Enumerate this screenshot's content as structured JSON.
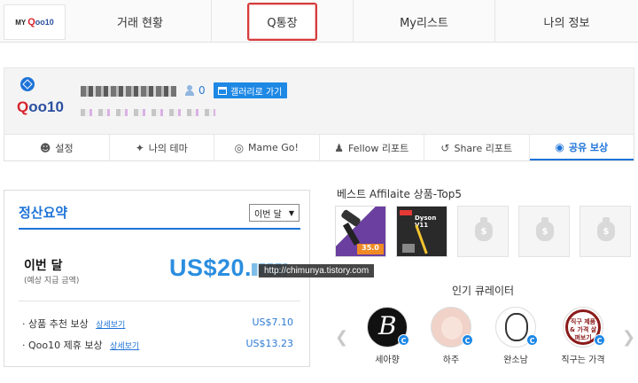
{
  "logo": {
    "my": "MY",
    "q": "Q",
    "rest": "oo10"
  },
  "nav": [
    {
      "label": "거래 현황"
    },
    {
      "label": "Q통장"
    },
    {
      "label": "My리스트"
    },
    {
      "label": "나의 정보"
    }
  ],
  "profile": {
    "logo_text_a": "Q",
    "logo_text_b": "oo10",
    "follower_count": "0",
    "gallery_button": "갤러리로 가기"
  },
  "subtabs": [
    {
      "label": "설정",
      "icon": "person-gear-icon"
    },
    {
      "label": "나의 테마",
      "icon": "magic-wand-icon"
    },
    {
      "label": "Mame Go!",
      "icon": "lifebuoy-icon"
    },
    {
      "label": "Fellow 리포트",
      "icon": "person-icon"
    },
    {
      "label": "Share 리포트",
      "icon": "share-icon"
    },
    {
      "label": "공유 보상",
      "icon": "piggy-bank-icon"
    }
  ],
  "settlement": {
    "title": "정산요약",
    "period_select": "이번 달",
    "month_label": "이번 달",
    "estimate_note": "(예상 지급 금액)",
    "amount_prefix": "US$20.",
    "rows": [
      {
        "label": "· 상품 추천 보상",
        "detail": "상세보기",
        "value": "US$7.10"
      },
      {
        "label": "· Qoo10 제휴 보상",
        "detail": "상세보기",
        "value": "US$13.23"
      }
    ]
  },
  "watermark": "http://chimunya.tistory.com",
  "best": {
    "title": "베스트 Affilaite 상품-Top5",
    "p1_tag": "35.0",
    "p2_label": "Dyson V11",
    "empty_icon": "$"
  },
  "curators": {
    "title": "인기 큐레이터",
    "badge": "C",
    "items": [
      {
        "name": "세아향",
        "avatar_letter": "B"
      },
      {
        "name": "하주"
      },
      {
        "name": "완소남"
      },
      {
        "name": "직구는 가격",
        "ring_text": "직구 제품 & 가격 살펴보기"
      }
    ]
  },
  "colors": {
    "accent": "#1e73d8",
    "brand_red": "#d8232a",
    "active_tab_border": "#d53b3b"
  }
}
